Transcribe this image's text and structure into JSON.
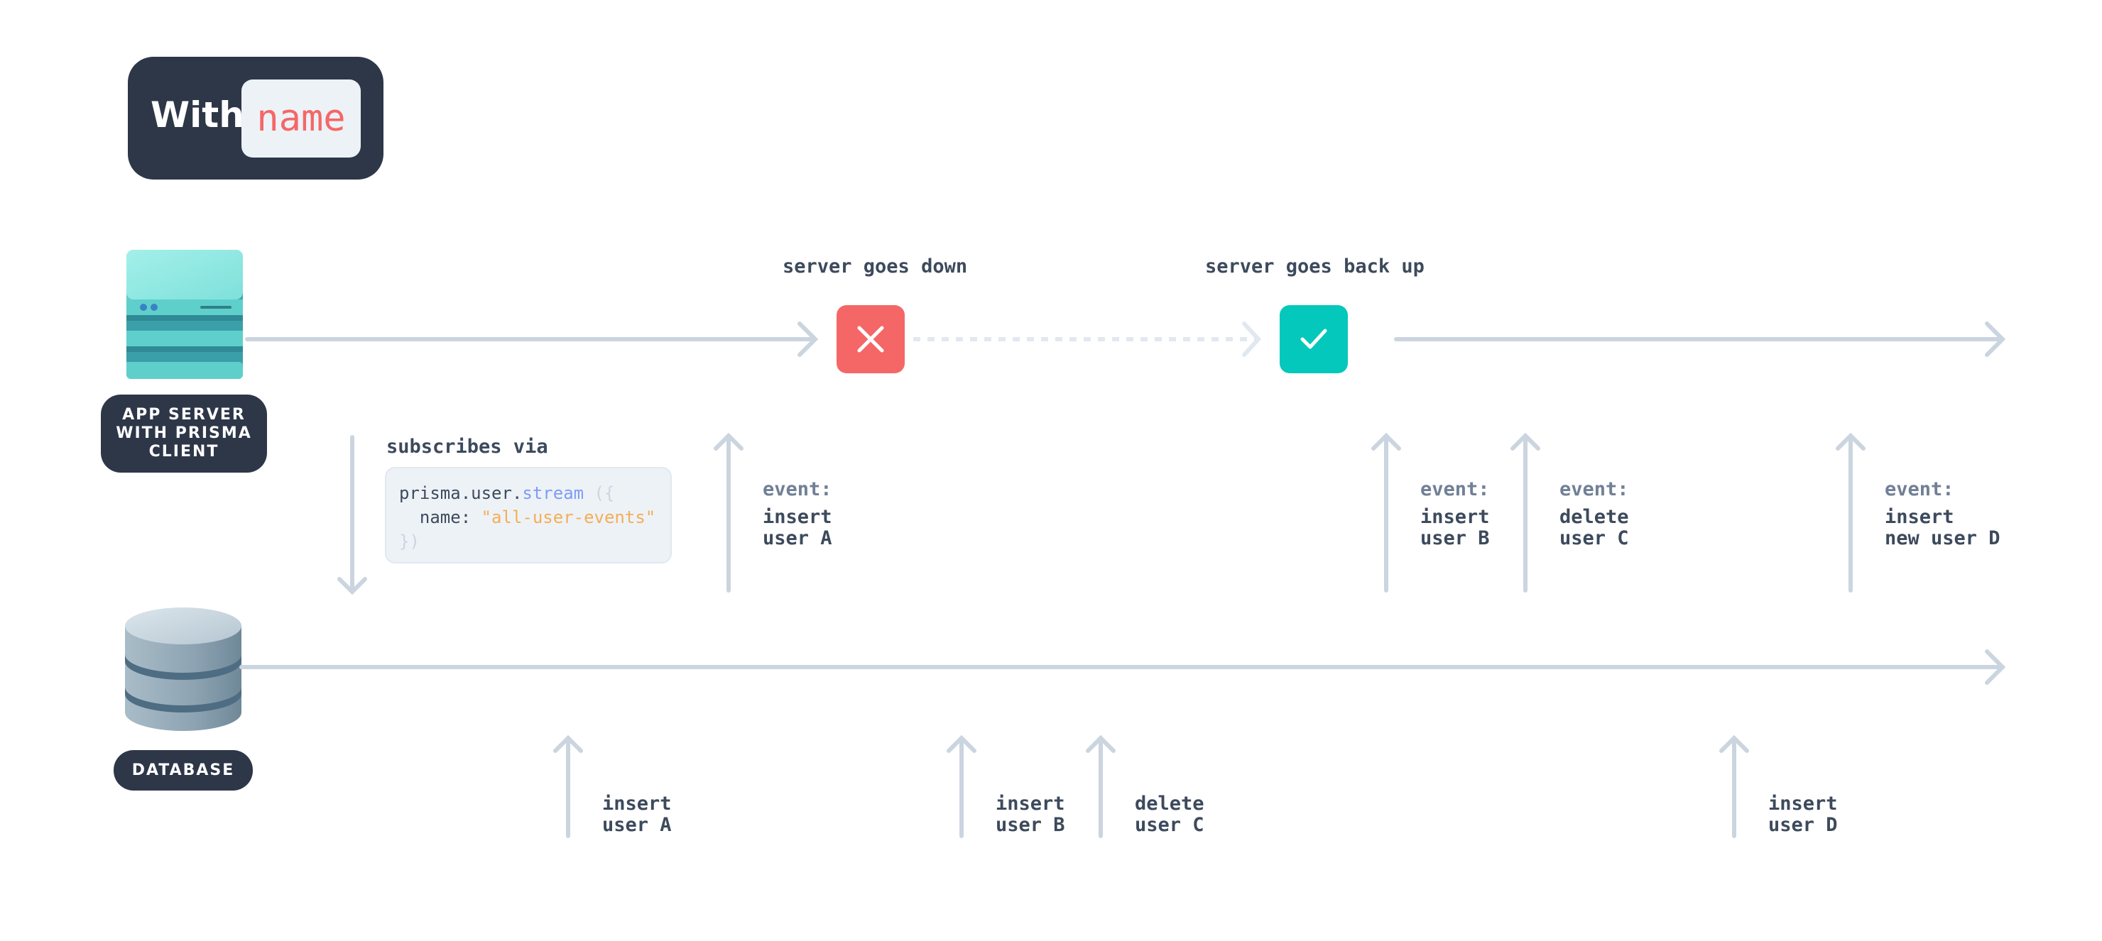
{
  "title": {
    "prefix": "With",
    "code": "name"
  },
  "nodes": {
    "app_server": {
      "label": "APP SERVER\nWITH PRISMA\nCLIENT",
      "icon": "server-icon"
    },
    "database": {
      "label": "DATABASE",
      "icon": "database-icon"
    }
  },
  "server_timeline": {
    "down_label": "server goes down",
    "up_label": "server goes back up",
    "down_icon": "x-icon",
    "up_icon": "check-icon"
  },
  "subscription": {
    "label": "subscribes via",
    "code": {
      "line1_object": "prisma.user.",
      "line1_method": "stream",
      "line1_punct": " ({",
      "line2_key": "  name: ",
      "line2_value": "\"all-user-events\"",
      "line3_punct": "})"
    }
  },
  "delivered_events": [
    {
      "head": "event:",
      "body": "insert\nuser A"
    },
    {
      "head": "event:",
      "body": "insert\nuser B"
    },
    {
      "head": "event:",
      "body": "delete\nuser C"
    },
    {
      "head": "event:",
      "body": "insert\nnew user D"
    }
  ],
  "db_operations": [
    {
      "body": "insert\nuser A"
    },
    {
      "body": "insert\nuser B"
    },
    {
      "body": "delete\nuser C"
    },
    {
      "body": "insert\nuser D"
    }
  ],
  "colors": {
    "navy": "#2D3748",
    "line": "#CBD5E0",
    "line_dashed": "#E2E8F0",
    "down": "#F56767",
    "up": "#04C8BB",
    "code_string": "#F6AD55",
    "code_method": "#7F9CF5"
  }
}
